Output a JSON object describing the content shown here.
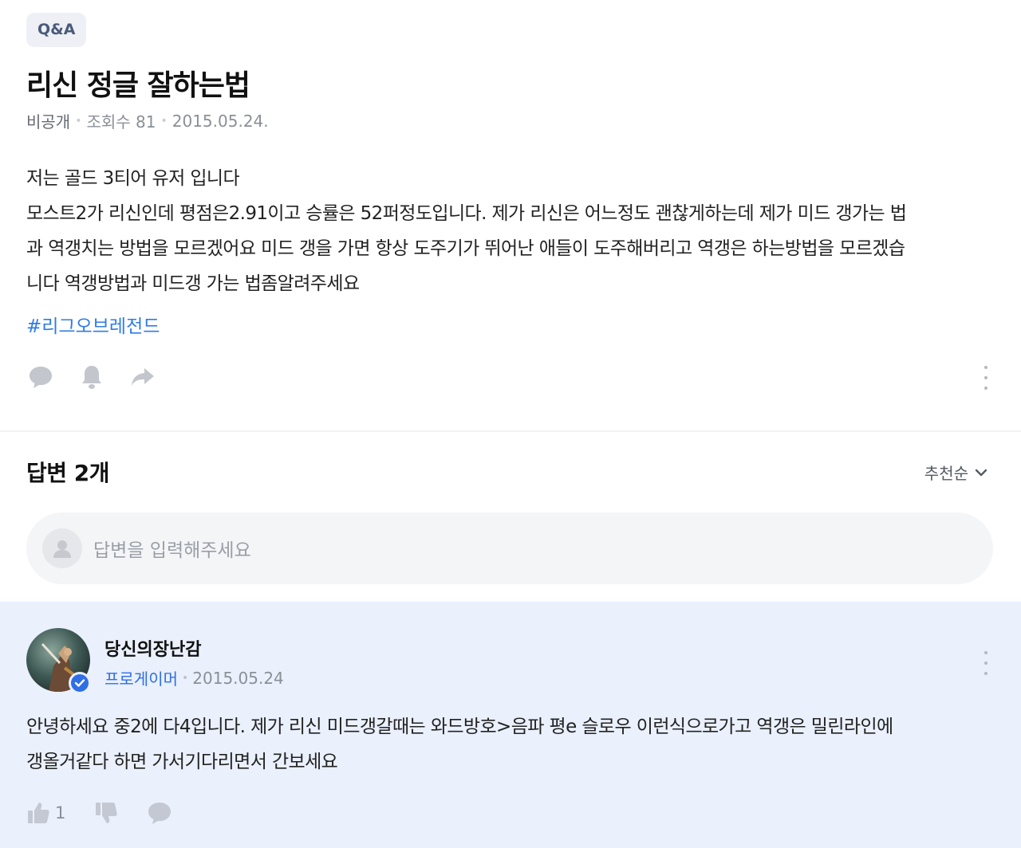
{
  "question": {
    "category_badge": "Q&A",
    "title": "리신 정글 잘하는법",
    "author": "비공개",
    "views_label": "조회수 81",
    "date": "2015.05.24.",
    "body_lines": [
      "저는 골드 3티어 유저 입니다",
      "모스트2가 리신인데 평점은2.91이고 승률은 52퍼정도입니다. 제가 리신은 어느정도 괜찮게하는데 제가 미드 갱가는 법",
      "과 역갱치는 방법을 모르겠어요 미드 갱을 가면 항상 도주기가 뛰어난 애들이 도주해버리고 역갱은 하는방법을 모르겠습",
      "니다 역갱방법과 미드갱 가는 법좀알려주세요"
    ],
    "hashtag": "#리그오브레전드",
    "actions": [
      "comment-icon",
      "bell-icon",
      "share-icon"
    ]
  },
  "answers_section": {
    "header": "답변 2개",
    "sort_label": "추천순",
    "input_placeholder": "답변을 입력해주세요"
  },
  "answer": {
    "author": "당신의장난감",
    "role": "프로게이머",
    "date": "2015.05.24",
    "body_lines": [
      "안녕하세요 중2에 다4입니다. 제가 리신 미드갱갈때는 와드방호>음파 평e 슬로우 이런식으로가고 역갱은 밀린라인에",
      "갱올거같다 하면 가서기다리면서 간보세요"
    ],
    "like_count": "1",
    "colors": {
      "background": "#eaf0fc",
      "accent": "#2f6fe6"
    }
  }
}
